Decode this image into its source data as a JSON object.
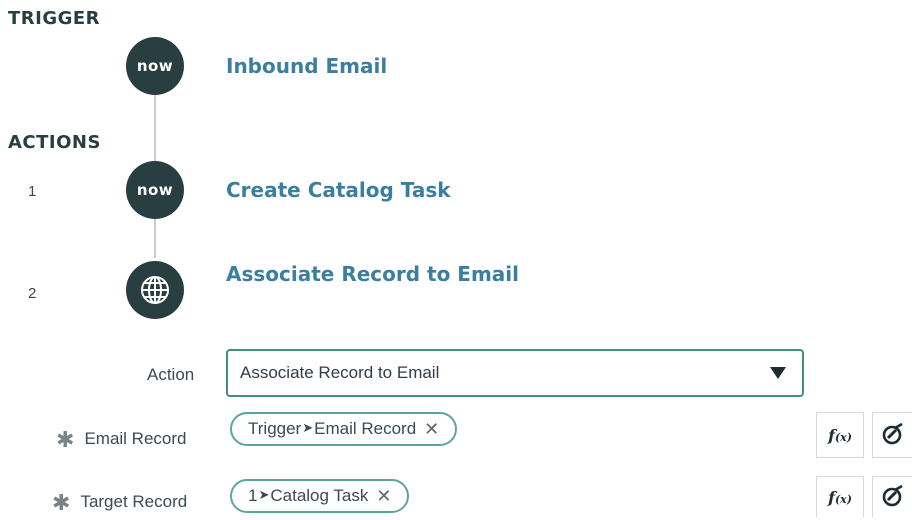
{
  "sections": {
    "trigger": "TRIGGER",
    "actions": "ACTIONS"
  },
  "trigger": {
    "logo": "now",
    "title": "Inbound Email"
  },
  "actions": [
    {
      "number": "1",
      "logo": "now",
      "title": "Create Catalog Task"
    },
    {
      "number": "2",
      "icon": "globe-icon",
      "title": "Associate Record to Email"
    }
  ],
  "form": {
    "action_label": "Action",
    "action_value": "Associate Record to Email",
    "email_record_label": "Email Record",
    "email_record_pill": {
      "source": "Trigger",
      "value": "Email Record"
    },
    "target_record_label": "Target Record",
    "target_record_pill": {
      "source": "1",
      "value": "Catalog Task"
    },
    "fx_label": "f",
    "fx_sub": "(x)",
    "pill_remove": "✕",
    "arrow_glyph": "➤",
    "required_glyph": "✱"
  },
  "colors": {
    "node": "#293e40",
    "link": "#3b7fa0",
    "accent": "#3f8f86"
  }
}
